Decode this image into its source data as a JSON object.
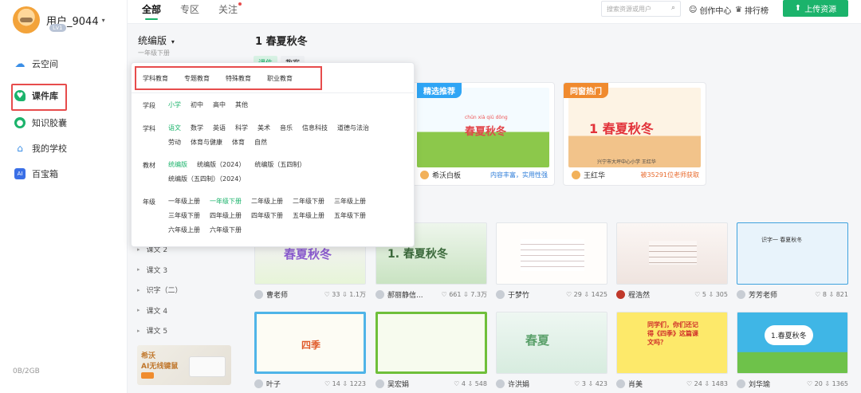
{
  "user": {
    "name": "用户_9044",
    "level": "Lv1"
  },
  "sidebar": {
    "items": [
      {
        "label": "云空间",
        "color": "#3a8ee6"
      },
      {
        "label": "课件库",
        "color": "#1bb36b",
        "active": true
      },
      {
        "label": "知识胶囊",
        "color": "#1bb36b"
      },
      {
        "label": "我的学校",
        "color": "#3a8ee6"
      },
      {
        "label": "百宝箱",
        "color": "#3a6fe6",
        "icon": "AI"
      }
    ],
    "storage": "0B/2GB"
  },
  "topbar": {
    "tabs": [
      "全部",
      "专区",
      "关注"
    ],
    "search_placeholder": "搜索资源或用户",
    "creator_center": "创作中心",
    "ranking": "排行榜",
    "upload": "上传资源"
  },
  "filter": {
    "edition": "统编版",
    "grade": "一年级下册",
    "chapters": [
      "课文 2",
      "课文 3",
      "识字（二）",
      "课文 4",
      "课文 5"
    ]
  },
  "promo": {
    "line1": "希沃",
    "line2": "AI无线键鼠"
  },
  "main": {
    "title": "1 春夏秋冬",
    "section_tabs": [
      "课件",
      "教案"
    ]
  },
  "featured": [
    {
      "flag": "精选推荐",
      "flag_color": "#2fa5f5",
      "author": "希沃白板",
      "note": "内容丰富，实用性强",
      "note_color": "#2b7bd8",
      "thumb_title": "春夏秋冬",
      "pinyin": "chūn xià qiū dōng"
    },
    {
      "flag": "同窗热门",
      "flag_color": "#f08a2e",
      "author": "王红华",
      "note": "被35291位老师获取",
      "note_color": "#e86a2c",
      "thumb_title": "1 春夏秋冬",
      "thumb_sub": "兴宁市大坪中心小学  王红华"
    }
  ],
  "cards": [
    {
      "author": "曹老师",
      "likes": "33",
      "downloads": "1.1万",
      "thumb_title": "春夏秋冬"
    },
    {
      "author": "郝丽静信...",
      "likes": "661",
      "downloads": "7.3万",
      "thumb_title": "1. 春夏秋冬"
    },
    {
      "author": "于梦竹",
      "likes": "29",
      "downloads": "1425",
      "thumb_title": ""
    },
    {
      "author": "程浩然",
      "likes": "5",
      "downloads": "305",
      "thumb_title": ""
    },
    {
      "author": "芳芳老师",
      "likes": "8",
      "downloads": "821",
      "thumb_title": "识字一 春夏秋冬"
    },
    {
      "author": "叶子",
      "likes": "14",
      "downloads": "1223",
      "thumb_title": "四季"
    },
    {
      "author": "吴宏娟",
      "likes": "4",
      "downloads": "548",
      "thumb_title": ""
    },
    {
      "author": "许洪娟",
      "likes": "3",
      "downloads": "423",
      "thumb_title": "春夏"
    },
    {
      "author": "肖美",
      "likes": "24",
      "downloads": "1483",
      "thumb_title": "同学们，你们还记得《四季》这篇课文吗？"
    },
    {
      "author": "刘华瑜",
      "likes": "20",
      "downloads": "1365",
      "thumb_title": "1.春夏秋冬"
    }
  ],
  "dropdown": {
    "tabs": [
      "学科教育",
      "专题教育",
      "特殊教育",
      "职业教育"
    ],
    "stage_label": "学段",
    "stages": [
      "小学",
      "初中",
      "高中",
      "其他"
    ],
    "subject_label": "学科",
    "subjects": [
      "语文",
      "数学",
      "英语",
      "科学",
      "美术",
      "音乐",
      "信息科技",
      "道德与法治",
      "劳动",
      "体育与健康",
      "体育",
      "自然"
    ],
    "textbook_label": "教材",
    "textbooks": [
      "统编版",
      "统编版（2024）",
      "统编版（五四制）",
      "统编版（五四制）（2024）"
    ],
    "grade_label": "年级",
    "grades": [
      "一年级上册",
      "一年级下册",
      "二年级上册",
      "二年级下册",
      "三年级上册",
      "三年级下册",
      "四年级上册",
      "四年级下册",
      "五年级上册",
      "五年级下册",
      "六年级上册",
      "六年级下册"
    ]
  }
}
